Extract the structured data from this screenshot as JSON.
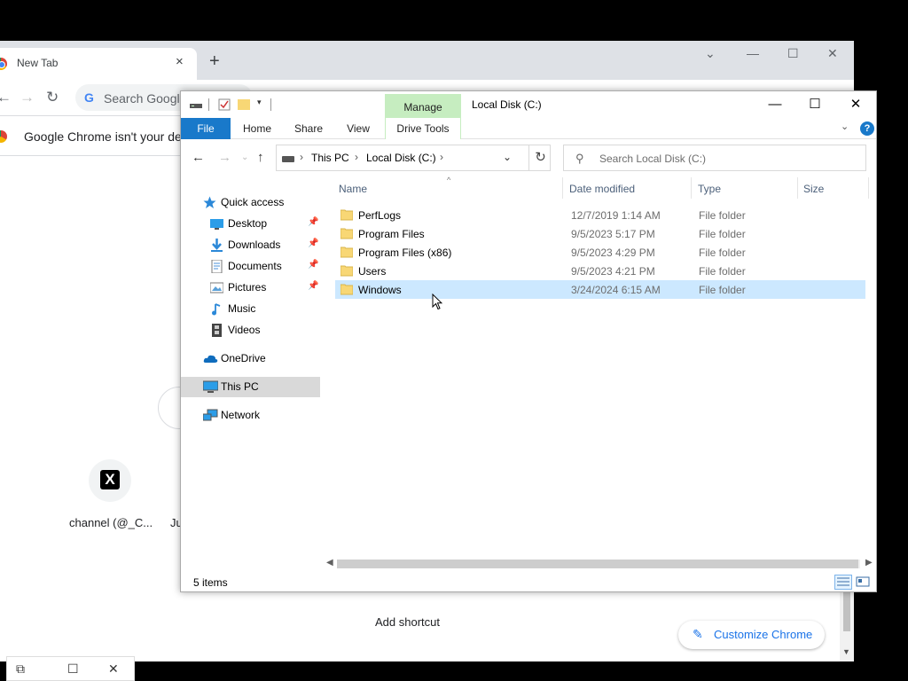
{
  "chrome": {
    "tab_title": "New Tab",
    "tab_close": "×",
    "new_tab": "+",
    "win_minimize": "—",
    "win_maximize": "☐",
    "win_close": "✕",
    "win_chevron": "⌄",
    "omnibox_placeholder": "Search Google",
    "infobar_text": "Google Chrome isn't your defa",
    "shortcut_label": "channel (@_C...",
    "shortcut_label2": "Ju",
    "add_shortcut_label": "Add shortcut",
    "customize_label": "Customize Chrome",
    "x_logo": "X"
  },
  "explorer": {
    "title": "Local Disk (C:)",
    "manage_tab": "Manage",
    "ribbon_tabs": {
      "file": "File",
      "home": "Home",
      "share": "Share",
      "view": "View",
      "drive_tools": "Drive Tools"
    },
    "help": "?",
    "address": {
      "crumbs": [
        "This PC",
        "Local Disk (C:)"
      ],
      "separator": "›"
    },
    "search_placeholder": "Search Local Disk (C:)",
    "nav": {
      "quick_access": "Quick access",
      "desktop": "Desktop",
      "downloads": "Downloads",
      "documents": "Documents",
      "pictures": "Pictures",
      "music": "Music",
      "videos": "Videos",
      "onedrive": "OneDrive",
      "this_pc": "This PC",
      "network": "Network"
    },
    "columns": {
      "name": "Name",
      "date": "Date modified",
      "type": "Type",
      "size": "Size"
    },
    "rows": [
      {
        "name": "PerfLogs",
        "date": "12/7/2019 1:14 AM",
        "type": "File folder"
      },
      {
        "name": "Program Files",
        "date": "9/5/2023 5:17 PM",
        "type": "File folder"
      },
      {
        "name": "Program Files (x86)",
        "date": "9/5/2023 4:29 PM",
        "type": "File folder"
      },
      {
        "name": "Users",
        "date": "9/5/2023 4:21 PM",
        "type": "File folder"
      },
      {
        "name": "Windows",
        "date": "3/24/2024 6:15 AM",
        "type": "File folder"
      }
    ],
    "status": "5 items"
  },
  "colors": {
    "file_tab": "#1979ca",
    "manage_tab": "#c6edc0",
    "selection": "#cce8ff",
    "folder": "#f8d775"
  }
}
